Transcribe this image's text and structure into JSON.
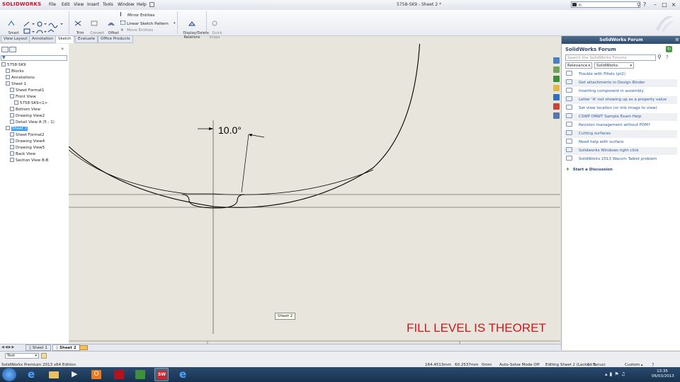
{
  "titlebar": {
    "logo": "SOLIDWORKS",
    "menus": [
      "File",
      "Edit",
      "View",
      "Insert",
      "Tools",
      "Window",
      "Help"
    ],
    "doc_title": "5758-SK9 - Sheet 2 *",
    "search_value": "n"
  },
  "toolbar": {
    "smart_dimension": "Smart\nDimension",
    "trim_entities": "Trim\nEntities",
    "convert_entities": "Convert\nEntities",
    "offset_entities": "Offset\nEntities",
    "mirror_entities": "Mirror Entities",
    "linear_sketch_pattern": "Linear Sketch Pattern",
    "move_entities": "Move Entities",
    "display_delete_relations": "Display/Delete\nRelations",
    "quick_snaps": "Quick\nSnaps"
  },
  "command_tabs": [
    "View Layout",
    "Annotation",
    "Sketch",
    "Evaluate",
    "Office Products"
  ],
  "command_tab_active": "Sketch",
  "tree": [
    {
      "label": "5758-SK9",
      "indent": 0
    },
    {
      "label": "Blocks",
      "indent": 1
    },
    {
      "label": "Annotations",
      "indent": 1
    },
    {
      "label": "Sheet 1",
      "indent": 1
    },
    {
      "label": "Sheet Format1",
      "indent": 2
    },
    {
      "label": "Front View",
      "indent": 2
    },
    {
      "label": "5758-SK9<1>",
      "indent": 3
    },
    {
      "label": "Bottom View",
      "indent": 2
    },
    {
      "label": "Drawing View2",
      "indent": 2
    },
    {
      "label": "Detail View A (5 : 1)",
      "indent": 2
    },
    {
      "label": "Sheet 2",
      "indent": 1,
      "selected": true
    },
    {
      "label": "Sheet Format2",
      "indent": 2
    },
    {
      "label": "Drawing View4",
      "indent": 2
    },
    {
      "label": "Drawing View5",
      "indent": 2
    },
    {
      "label": "Back View",
      "indent": 2
    },
    {
      "label": "Section View B-B",
      "indent": 2
    }
  ],
  "canvas": {
    "dimension_label": "10.0°",
    "sheet_tooltip": "Sheet 2",
    "note_text": "FILL LEVEL IS THEORET",
    "note_color": "#d4141b"
  },
  "forum": {
    "panel_title": "SolidWorks Forum",
    "heading": "SolidWorks Forum",
    "search_placeholder": "Search the SolidWorks Forums",
    "sort_select": "Relevance",
    "scope_select": "SolidWorks",
    "topics": [
      "Trouble with Fillets (pt2)",
      "Get attachments in Design Binder",
      "Inserting component in assembly",
      "Letter 'A' not showing up as a property value",
      "Set view location (or link image to view)",
      "CSWP DRWT Sample Exam Help",
      "Revision management without PDM?",
      "Cutting surfaces",
      "Need help with surface",
      "Solidworks Windows right click",
      "SolidWorks 2013 Wacom Tablet problem"
    ],
    "start_discussion": "Start a Discussion"
  },
  "sheet_tabs": [
    "Sheet 1",
    "Sheet 2"
  ],
  "sheet_tab_active": "Sheet 2",
  "layer_select": "Text",
  "status": {
    "edition": "SolidWorks Premium 2013 x64 Edition",
    "x": "164.4513mm",
    "y": "60.2537mm",
    "z": "0mm",
    "solve_mode": "Auto-Solve Mode Off",
    "editing": "Editing Sheet 2 (Locked Focus)",
    "scale": "1 : 1",
    "units": "Custom"
  },
  "clock": {
    "time": "13:35",
    "date": "06/03/2013"
  },
  "colors": {
    "accent": "#3399ff",
    "logo_red": "#c8102e",
    "forum_header": "#2f4a6d",
    "taskbar": "#17324f"
  }
}
